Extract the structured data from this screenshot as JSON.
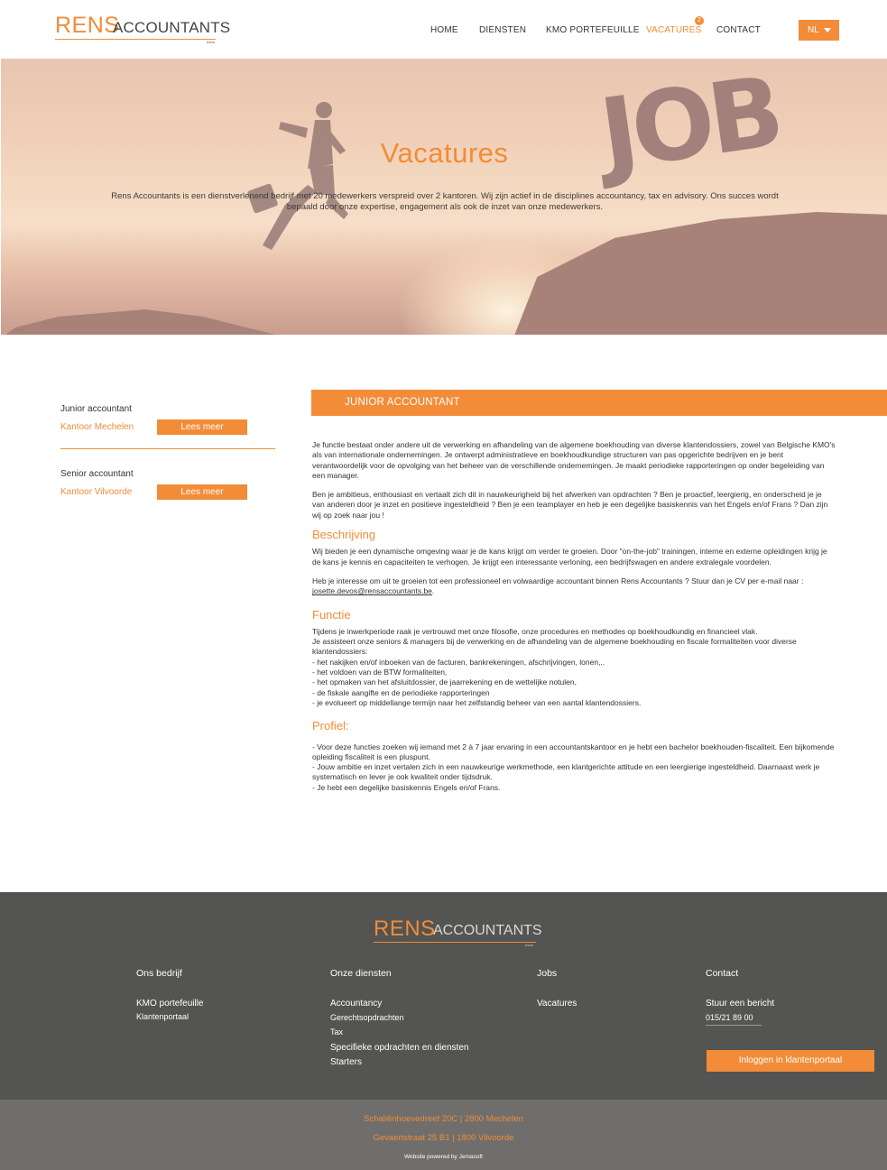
{
  "brand": {
    "name_primary": "RENS",
    "name_secondary": "ACCOUNTANTS",
    "suffix": "bvba",
    "accent_color": "#f28c38"
  },
  "nav": {
    "items": [
      {
        "label": "HOME"
      },
      {
        "label": "DIENSTEN"
      },
      {
        "label": "KMO PORTEFEUILLE"
      },
      {
        "label": "VACATURES",
        "active": true,
        "badge": "2"
      },
      {
        "label": "CONTACT"
      }
    ],
    "language": "NL"
  },
  "hero": {
    "title": "Vacatures",
    "image_text": "JOB",
    "intro": "Rens Accountants is een dienstverlenend bedrijf met 20 medewerkers verspreid over 2 kantoren. Wij zijn actief in de disciplines accountancy, tax en advisory. Ons succes wordt bepaald door onze expertise, engagement als ook de inzet van onze medewerkers."
  },
  "jobs": [
    {
      "title": "Junior accountant",
      "office": "Kantoor Mechelen",
      "button": "Lees meer"
    },
    {
      "title": "Senior accountant",
      "office": "Kantoor Vilvoorde",
      "button": "Lees meer"
    }
  ],
  "detail": {
    "header": "JUNIOR ACCOUNTANT",
    "intro_1": "Je functie bestaat onder andere uit de verwerking en afhandeling van de algemene boekhouding van diverse klantendossiers, zowel van Belgische KMO's als van internationale ondernemingen. Je ontwerpt administratieve en boekhoudkundige structuren van pas opgerichte bedrijven en je bent verantwoordelijk voor de opvolging van het beheer van de verschillende ondernemingen. Je maakt periodieke rapporteringen op onder begeleiding van een manager.",
    "intro_2": "Ben je ambitieus, enthousiast en vertaalt zich dit in nauwkeurigheid bij het afwerken van opdrachten ? Ben je proactief, leergierig, en onderscheid je je van anderen door je inzet en positieve ingesteldheid ? Ben je een teamplayer en heb je een degelijke basiskennis van het Engels en/of Frans ? Dan zijn wij op zoek naar jou !",
    "section_beschrijving": "Beschrijving",
    "beschrijving_1": "Wij bieden je een dynamische omgeving waar je de kans krijgt om verder te groeien. Door \"on-the-job\" trainingen, interne en externe opleidingen krijg je de kans je kennis en capaciteiten te verhogen. Je krijgt een interessante verloning, een bedrijfswagen en andere extralegale voordelen.",
    "beschrijving_2": "Heb je interesse om uit te groeien tot een professioneel en volwaardige accountant binnen Rens Accountants ? Stuur dan je CV per e-mail naar : ",
    "email": "josette.devos@rensaccountants.be",
    "email_suffix": ".",
    "section_functie": "Functie",
    "functie_1": "Tijdens je inwerkperiode raak je vertrouwd met onze filosofie, onze procedures en methodes op boekhoudkundig en financieel vlak.",
    "functie_2": "Je assisteert onze seniors & managers bij de verwerking en de afhandeling van de algemene boekhouding en fiscale formaliteiten voor diverse klantendossiers:",
    "functie_list": [
      "-  het nakijken en/of inboeken van de facturen, bankrekeningen, afschrijvingen, lonen,..",
      "-  het voldoen van de BTW formaliteiten,",
      "-  het opmaken van het afsluitdossier, de jaarrekening en de wettelijke notulen,",
      "-  de fiskale aangifte en de periodieke rapporteringen",
      "-  je evolueert op middellange termijn naar het zelfstandig beheer van een aantal klantendossiers."
    ],
    "section_profiel": "Profiel:",
    "profiel_list": [
      " - Voor deze functies zoeken wij iemand met 2 à 7 jaar ervaring in een accountantskantoor en je hebt een bachelor boekhouden-fiscaliteit. Een bijkomende opleiding fiscaliteit is een pluspunt.",
      " - Jouw ambitie en inzet vertalen zich in een nauwkeurige werkmethode, een klantgerichte attitude en een leergierige ingesteldheid. Daarnaast werk je systematisch en lever je ook kwaliteit onder tijdsdruk.",
      " - Je hebt een degelijke basiskennis Engels en/of Frans."
    ]
  },
  "footer": {
    "col1": {
      "heading": "Ons bedrijf",
      "links": [
        "KMO portefeuille",
        "Klantenportaal"
      ]
    },
    "col2": {
      "heading": "Onze diensten",
      "links": [
        "Accountancy",
        "Gerechtsopdrachten",
        "Tax",
        "Specifieke opdrachten en diensten",
        "Starters"
      ]
    },
    "col3": {
      "heading": "Jobs",
      "links": [
        "Vacatures"
      ]
    },
    "col4": {
      "heading": "Contact",
      "links": [
        "Stuur een bericht"
      ],
      "phone": "015/21 89 00"
    },
    "portal_button": "Inloggen in klantenportaal",
    "address_1": "Schaliënhoevedreef 20C | 2800 Mechelen",
    "address_2": "Gevaertstraat 25 B1 | 1800 Vilvoorde",
    "powered_by": "Website powered by Jemasoft"
  }
}
